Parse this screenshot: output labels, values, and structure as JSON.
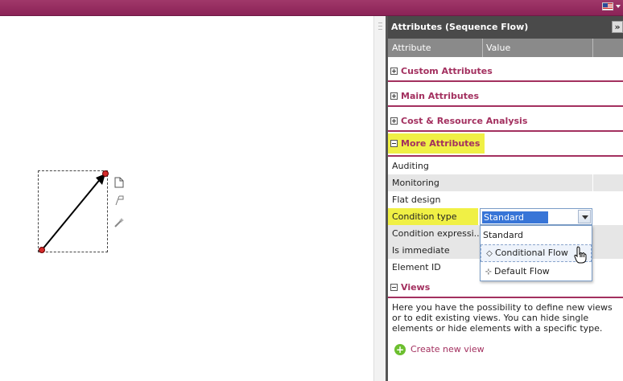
{
  "panel": {
    "title": "Attributes (Sequence Flow)",
    "collapse_icon": "»",
    "columns": [
      "Attribute",
      "Value"
    ]
  },
  "sections": {
    "custom": "Custom Attributes",
    "main": "Main Attributes",
    "cost": "Cost & Resource Analysis",
    "more": "More Attributes",
    "views": "Views"
  },
  "attributes": [
    {
      "label": "Auditing"
    },
    {
      "label": "Monitoring"
    },
    {
      "label": "Flat design"
    },
    {
      "label": "Condition type"
    },
    {
      "label": "Condition expressi..."
    },
    {
      "label": "Is immediate"
    },
    {
      "label": "Element ID"
    }
  ],
  "condition_type": {
    "selected": "Standard",
    "options": [
      {
        "label": "Standard",
        "icon": ""
      },
      {
        "label": "Conditional Flow",
        "icon": "◇"
      },
      {
        "label": "Default Flow",
        "icon": "⊹"
      }
    ]
  },
  "views": {
    "description": "Here you have the possibility to define new views or to edit existing views. You can hide single elements or hide elements with a specific type.",
    "create_label": "Create new view"
  },
  "canvas_tools": [
    "document-icon",
    "flag-icon",
    "wand-icon"
  ],
  "colors": {
    "accent": "#a3305f",
    "highlight": "#f0f045",
    "selection": "#3875d7",
    "topbar": "#8b2257"
  }
}
